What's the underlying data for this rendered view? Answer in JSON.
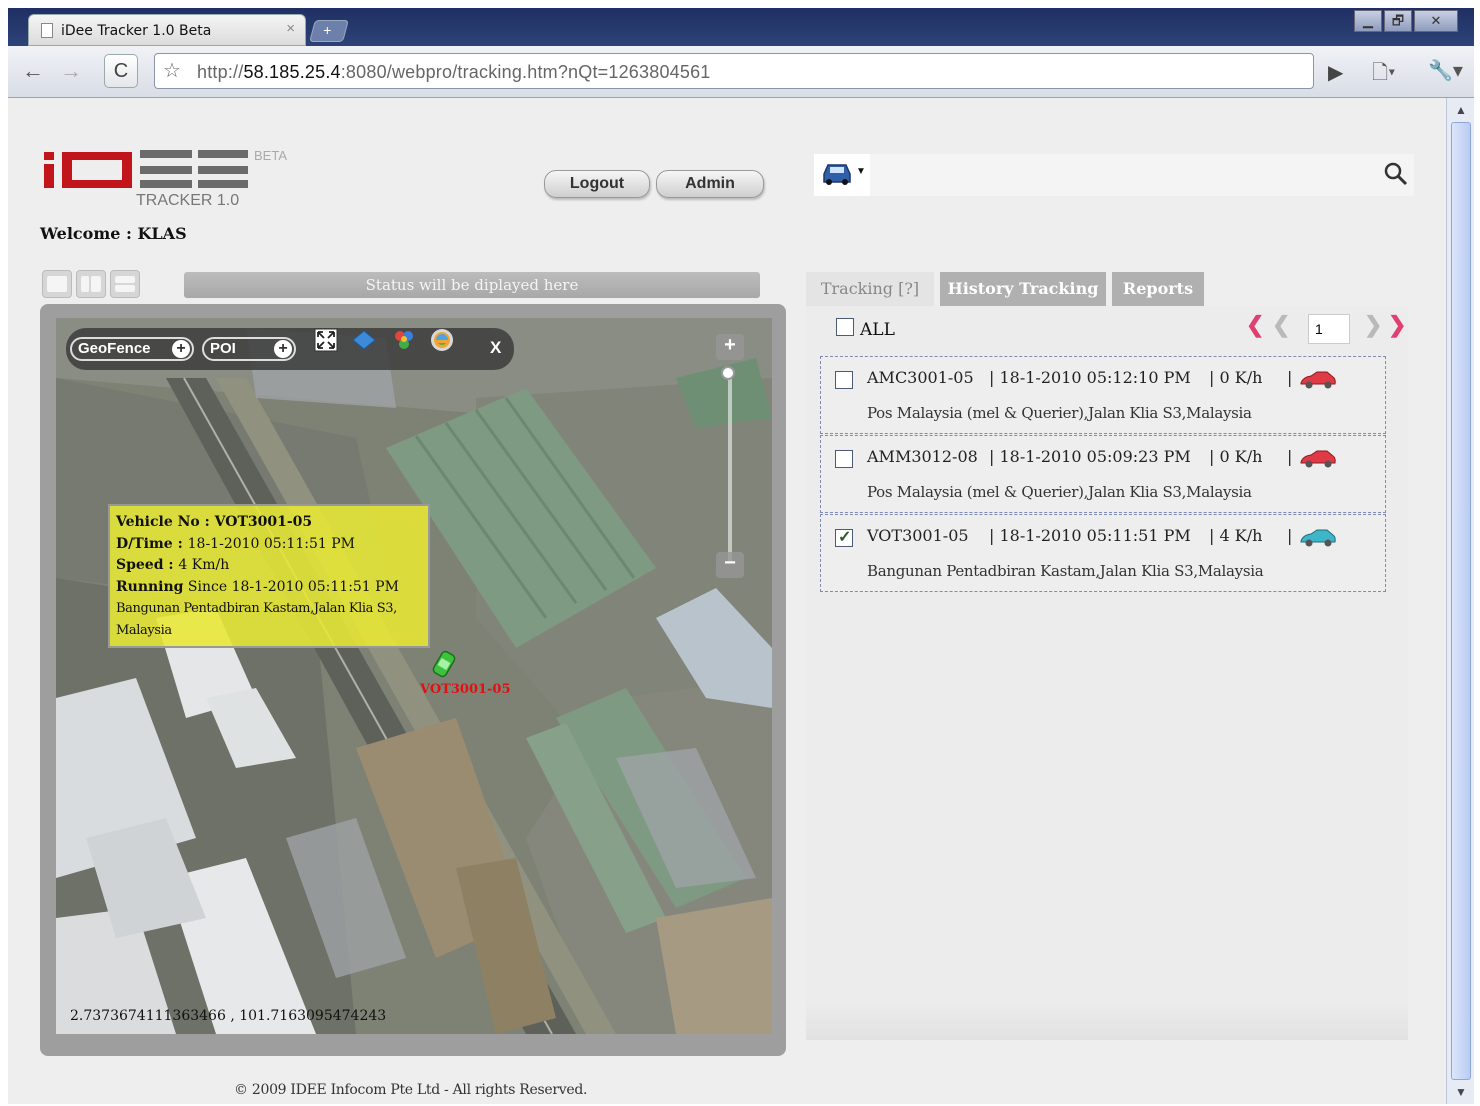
{
  "browser": {
    "tab_title": "iDee Tracker 1.0 Beta",
    "tab_close": "×",
    "new_tab": "+",
    "url_prefix": "http://",
    "url_host": "58.185.25.4",
    "url_rest": ":8080/webpro/tracking.htm?nQt=1263804561",
    "back": "←",
    "forward": "→",
    "reload": "C",
    "star": "☆",
    "go": "▶",
    "page_menu": "🗋▾",
    "tools_menu": "🔧▾",
    "win_minimize": "▁",
    "win_maximize": "🗗",
    "win_close": "✕"
  },
  "header": {
    "beta": "BETA",
    "version": "TRACKER 1.0",
    "welcome": "Welcome : KLAS",
    "logout": "Logout",
    "admin": "Admin",
    "brand_colors": {
      "red": "#c2151b",
      "gray": "#6b6b6b"
    }
  },
  "status": {
    "text": "Status will be diplayed here"
  },
  "map_tools": {
    "geofence": "GeoFence",
    "poi": "POI",
    "plus": "+",
    "close": "X",
    "icons": [
      "fullscreen-icon",
      "map-layer-icon",
      "google-maps-icon",
      "satellite-globe-icon"
    ]
  },
  "zoom": {
    "plus": "+",
    "minus": "−"
  },
  "popup": {
    "vehicle_label": "Vehicle No : ",
    "vehicle": "VOT3001-05",
    "dtime_label": "D/Time : ",
    "dtime": "18-1-2010 05:11:51 PM",
    "speed_label": "Speed : ",
    "speed": "4 Km/h",
    "running_label": "Running",
    "running": " Since 18-1-2010 05:11:51 PM",
    "address_1": "Bangunan Pentadbiran Kastam,Jalan Klia S3,",
    "address_2": "Malaysia"
  },
  "map": {
    "vehicle_label": "VOT3001-05",
    "coordinates": "2.7373674111363466 , 101.7163095474243"
  },
  "footer": {
    "copyright": "© 2009 IDEE Infocom Pte Ltd - All rights Reserved."
  },
  "panel": {
    "tabs": [
      {
        "label": "Tracking [?]",
        "active": true
      },
      {
        "label": "History Tracking",
        "active": false
      },
      {
        "label": "Reports",
        "active": false
      }
    ],
    "all_label": "ALL",
    "page": "1",
    "pager": {
      "first": "❮",
      "prev": "❮",
      "next": "❯",
      "last": "❯"
    },
    "vehicles": [
      {
        "plate": "AMC3001-05",
        "datetime": "| 18-1-2010 05:12:10 PM",
        "speed": "| 0 K/h",
        "sep": "|",
        "address": "Pos Malaysia (mel & Querier),Jalan Klia S3,Malaysia",
        "checked": false,
        "car_color": "#e03a46"
      },
      {
        "plate": "AMM3012-08",
        "datetime": "| 18-1-2010 05:09:23 PM",
        "speed": "| 0 K/h",
        "sep": "|",
        "address": "Pos Malaysia (mel & Querier),Jalan Klia S3,Malaysia",
        "checked": false,
        "car_color": "#e03a46"
      },
      {
        "plate": "VOT3001-05",
        "datetime": "| 18-1-2010 05:11:51 PM",
        "speed": "| 4 K/h",
        "sep": "|",
        "address": "Bangunan Pentadbiran Kastam,Jalan Klia S3,Malaysia",
        "checked": true,
        "car_color": "#3fb5c9"
      }
    ]
  }
}
